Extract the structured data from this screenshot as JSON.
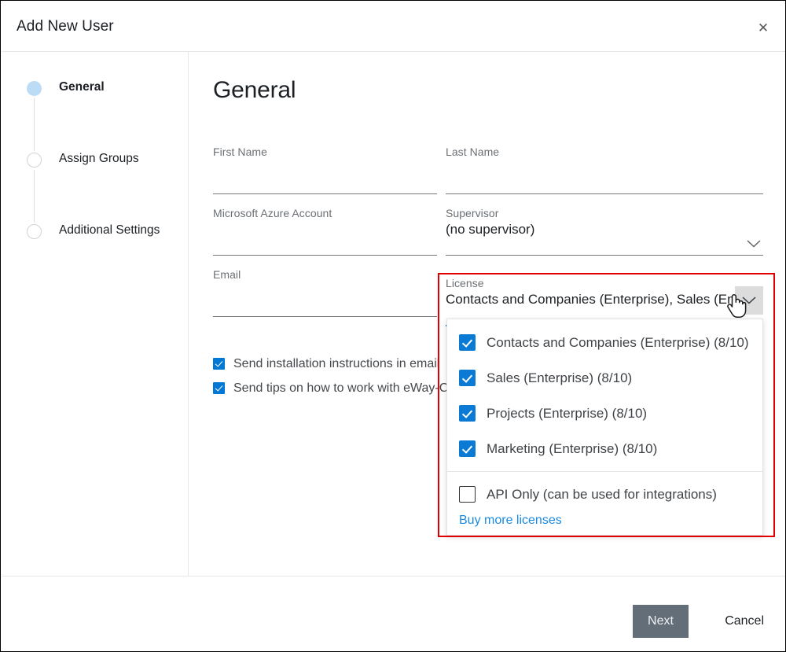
{
  "dialog": {
    "title": "Add New User",
    "close_icon": "close-icon"
  },
  "sidebar": {
    "steps": [
      {
        "label": "General",
        "state": "active"
      },
      {
        "label": "Assign Groups",
        "state": "inactive"
      },
      {
        "label": "Additional Settings",
        "state": "inactive"
      }
    ]
  },
  "main": {
    "page_title": "General",
    "fields": {
      "first_name": {
        "label": "First Name",
        "value": ""
      },
      "last_name": {
        "label": "Last Name",
        "value": ""
      },
      "azure_account": {
        "label": "Microsoft Azure Account",
        "value": ""
      },
      "supervisor": {
        "label": "Supervisor",
        "value": "(no supervisor)",
        "chevron_icon": "chevron-down-icon"
      },
      "email": {
        "label": "Email",
        "value": ""
      },
      "license": {
        "label": "License",
        "value": "Contacts and Companies (Enterprise), Sales (Ent",
        "chevron_icon": "chevron-down-icon"
      }
    },
    "options": [
      {
        "label": "Send installation instructions in email",
        "checked": true
      },
      {
        "label": "Send tips on how to work with eWay-CRM",
        "checked": true
      }
    ]
  },
  "license_dropdown": {
    "items": [
      {
        "label": "Contacts and Companies (Enterprise) (8/10)",
        "checked": true
      },
      {
        "label": "Sales (Enterprise) (8/10)",
        "checked": true
      },
      {
        "label": "Projects (Enterprise) (8/10)",
        "checked": true
      },
      {
        "label": "Marketing (Enterprise) (8/10)",
        "checked": true
      },
      {
        "label": "API Only (can be used for integrations)",
        "checked": false
      }
    ],
    "buy_link": "Buy more licenses"
  },
  "footer": {
    "next_label": "Next",
    "cancel_label": "Cancel"
  },
  "colors": {
    "accent_blue": "#0078d4",
    "highlight_red": "#e00000",
    "next_button": "#646e78",
    "link_blue": "#1a8ae0",
    "active_step": "#bcdcf5"
  },
  "cursor": {
    "type": "pointer-hand-cursor"
  }
}
